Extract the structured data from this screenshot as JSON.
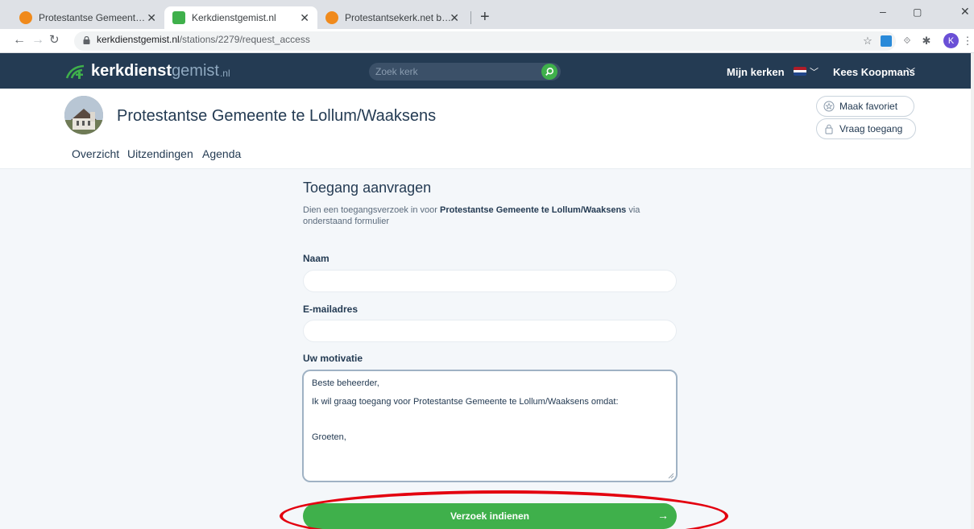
{
  "browser": {
    "tabs": [
      {
        "title": "Protestantse Gemeente te Lollum",
        "fav_color": "#f08a1c"
      },
      {
        "title": "Kerkdienstgemist.nl",
        "fav_color": "#3fb04b"
      },
      {
        "title": "Protestantsekerk.net beheer",
        "fav_color": "#f08a1c"
      }
    ],
    "tab_close": "✕",
    "new_tab": "+",
    "url_host": "kerkdienstgemist.nl",
    "url_path": "/stations/2279/request_access",
    "profile_initial": "K",
    "window_controls": [
      "–",
      "▢",
      "✕"
    ]
  },
  "site": {
    "logo_bold": "kerkdienst",
    "logo_light": "gemist",
    "logo_tld": ".nl",
    "search_placeholder": "Zoek kerk",
    "my_churches": "Mijn kerken",
    "user_name": "Kees Koopmans"
  },
  "church": {
    "name": "Protestantse Gemeente te Lollum/Waaksens",
    "nav": [
      "Overzicht",
      "Uitzendingen",
      "Agenda"
    ],
    "favorite_button": "Maak favoriet",
    "access_button": "Vraag toegang"
  },
  "form": {
    "title": "Toegang aanvragen",
    "desc_prefix": "Dien een toegangsverzoek in voor ",
    "desc_bold": "Protestantse Gemeente te Lollum/Waaksens",
    "desc_suffix": " via onderstaand formulier",
    "name_label": "Naam",
    "name_value": "",
    "email_label": "E-mailadres",
    "email_value": "",
    "motivation_label": "Uw motivatie",
    "motivation_lines": [
      "Beste beheerder,",
      "Ik wil graag toegang voor Protestantse Gemeente te Lollum/Waaksens omdat:",
      "Groeten,"
    ],
    "submit_label": "Verzoek indienen",
    "submit_arrow": "→"
  },
  "colors": {
    "header": "#243b53",
    "accent_green": "#3fb04b",
    "highlight_red": "#e3000f"
  }
}
